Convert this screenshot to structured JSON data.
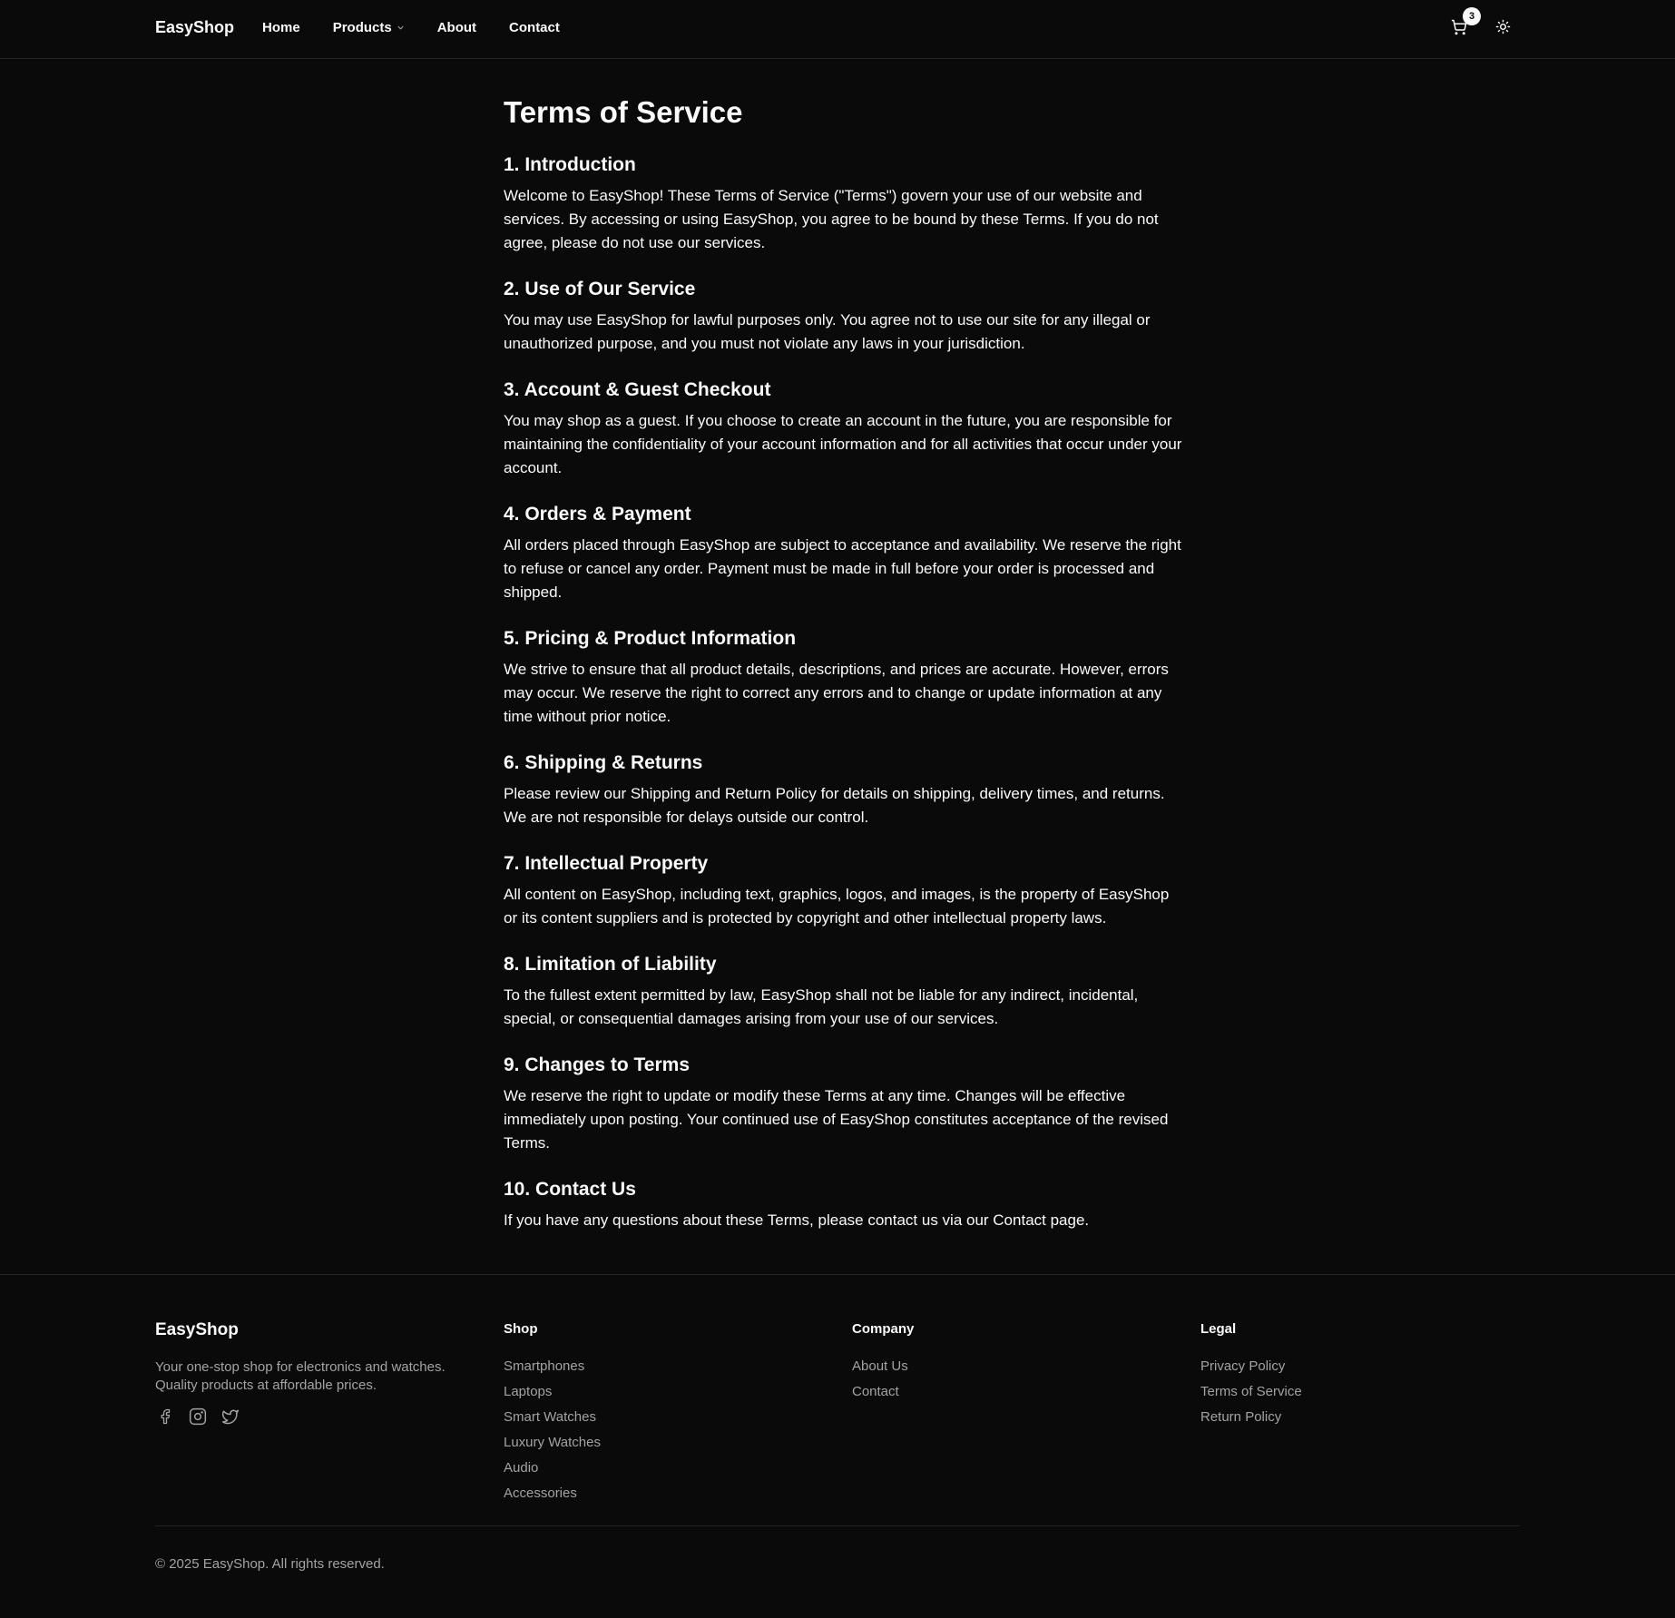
{
  "header": {
    "brand": "EasyShop",
    "nav": {
      "home": "Home",
      "products": "Products",
      "about": "About",
      "contact": "Contact"
    },
    "cart_count": "3",
    "icons": {
      "cart": "shopping-cart-icon",
      "theme": "sun-icon",
      "chevron": "chevron-down-icon"
    }
  },
  "main": {
    "title": "Terms of Service",
    "sections": [
      {
        "heading": "1. Introduction",
        "body": "Welcome to EasyShop! These Terms of Service (\"Terms\") govern your use of our website and services. By accessing or using EasyShop, you agree to be bound by these Terms. If you do not agree, please do not use our services."
      },
      {
        "heading": "2. Use of Our Service",
        "body": "You may use EasyShop for lawful purposes only. You agree not to use our site for any illegal or unauthorized purpose, and you must not violate any laws in your jurisdiction."
      },
      {
        "heading": "3. Account & Guest Checkout",
        "body": "You may shop as a guest. If you choose to create an account in the future, you are responsible for maintaining the confidentiality of your account information and for all activities that occur under your account."
      },
      {
        "heading": "4. Orders & Payment",
        "body": "All orders placed through EasyShop are subject to acceptance and availability. We reserve the right to refuse or cancel any order. Payment must be made in full before your order is processed and shipped."
      },
      {
        "heading": "5. Pricing & Product Information",
        "body": "We strive to ensure that all product details, descriptions, and prices are accurate. However, errors may occur. We reserve the right to correct any errors and to change or update information at any time without prior notice."
      },
      {
        "heading": "6. Shipping & Returns",
        "body": "Please review our Shipping and Return Policy for details on shipping, delivery times, and returns. We are not responsible for delays outside our control."
      },
      {
        "heading": "7. Intellectual Property",
        "body": "All content on EasyShop, including text, graphics, logos, and images, is the property of EasyShop or its content suppliers and is protected by copyright and other intellectual property laws."
      },
      {
        "heading": "8. Limitation of Liability",
        "body": "To the fullest extent permitted by law, EasyShop shall not be liable for any indirect, incidental, special, or consequential damages arising from your use of our services."
      },
      {
        "heading": "9. Changes to Terms",
        "body": "We reserve the right to update or modify these Terms at any time. Changes will be effective immediately upon posting. Your continued use of EasyShop constitutes acceptance of the revised Terms."
      },
      {
        "heading": "10. Contact Us",
        "body": "If you have any questions about these Terms, please contact us via our Contact page."
      }
    ]
  },
  "footer": {
    "brand": "EasyShop",
    "description": "Your one-stop shop for electronics and watches. Quality products at affordable prices.",
    "social": [
      "facebook-icon",
      "instagram-icon",
      "twitter-icon"
    ],
    "shop": {
      "heading": "Shop",
      "links": [
        "Smartphones",
        "Laptops",
        "Smart Watches",
        "Luxury Watches",
        "Audio",
        "Accessories"
      ]
    },
    "company": {
      "heading": "Company",
      "links": [
        "About Us",
        "Contact"
      ]
    },
    "legal": {
      "heading": "Legal",
      "links": [
        "Privacy Policy",
        "Terms of Service",
        "Return Policy"
      ]
    },
    "copyright": "© 2025 EasyShop. All rights reserved."
  }
}
